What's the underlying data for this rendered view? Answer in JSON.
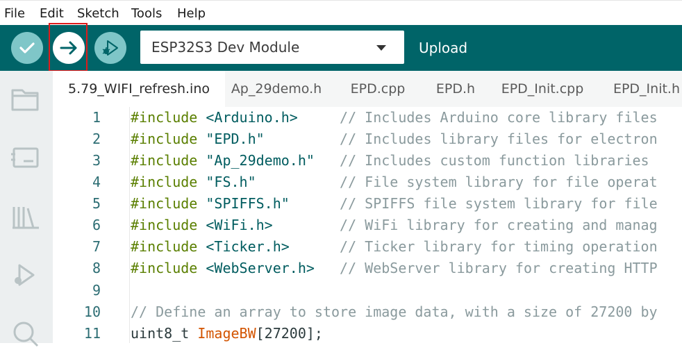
{
  "menu": [
    "File",
    "Edit",
    "Sketch",
    "Tools",
    "Help"
  ],
  "toolbar": {
    "verify_icon": "check-icon",
    "upload_icon": "arrow-right-icon",
    "debug_icon": "debug-icon",
    "board": "ESP32S3 Dev Module",
    "action_label": "Upload"
  },
  "sidebar": [
    "folder-icon",
    "board-icon",
    "library-icon",
    "debug-icon",
    "search-icon"
  ],
  "tabs": [
    "5.79_WIFI_refresh.ino",
    "Ap_29demo.h",
    "EPD.cpp",
    "EPD.h",
    "EPD_Init.cpp",
    "EPD_Init.h"
  ],
  "colors": {
    "teal": "#006468",
    "button": "#7fc6c8",
    "highlight": "#e01b1b"
  },
  "code": [
    {
      "n": "1",
      "kw": "#include ",
      "str": "<Arduino.h>",
      "pad": "     ",
      "cm": "// Includes Arduino core library files"
    },
    {
      "n": "2",
      "kw": "#include ",
      "str": "\"EPD.h\"",
      "pad": "         ",
      "cm": "// Includes library files for electron"
    },
    {
      "n": "3",
      "kw": "#include ",
      "str": "\"Ap_29demo.h\"",
      "pad": "   ",
      "cm": "// Includes custom function libraries"
    },
    {
      "n": "4",
      "kw": "#include ",
      "str": "\"FS.h\"",
      "pad": "          ",
      "cm": "// File system library for file operat"
    },
    {
      "n": "5",
      "kw": "#include ",
      "str": "\"SPIFFS.h\"",
      "pad": "      ",
      "cm": "// SPIFFS file system library for file"
    },
    {
      "n": "6",
      "kw": "#include ",
      "str": "<WiFi.h>",
      "pad": "        ",
      "cm": "// WiFi library for creating and manag"
    },
    {
      "n": "7",
      "kw": "#include ",
      "str": "<Ticker.h>",
      "pad": "      ",
      "cm": "// Ticker library for timing operation"
    },
    {
      "n": "8",
      "kw": "#include ",
      "str": "<WebServer.h>",
      "pad": "   ",
      "cm": "// WebServer library for creating HTTP"
    },
    {
      "n": "9",
      "kw": "",
      "str": "",
      "pad": "",
      "cm": ""
    },
    {
      "n": "10",
      "kw": "",
      "str": "",
      "pad": "",
      "cm": "// Define an array to store image data, with a size of 27200 by"
    },
    {
      "n": "11",
      "kw": "uint8_t ",
      "fn": "ImageBW",
      "rest": "[27200];"
    }
  ]
}
